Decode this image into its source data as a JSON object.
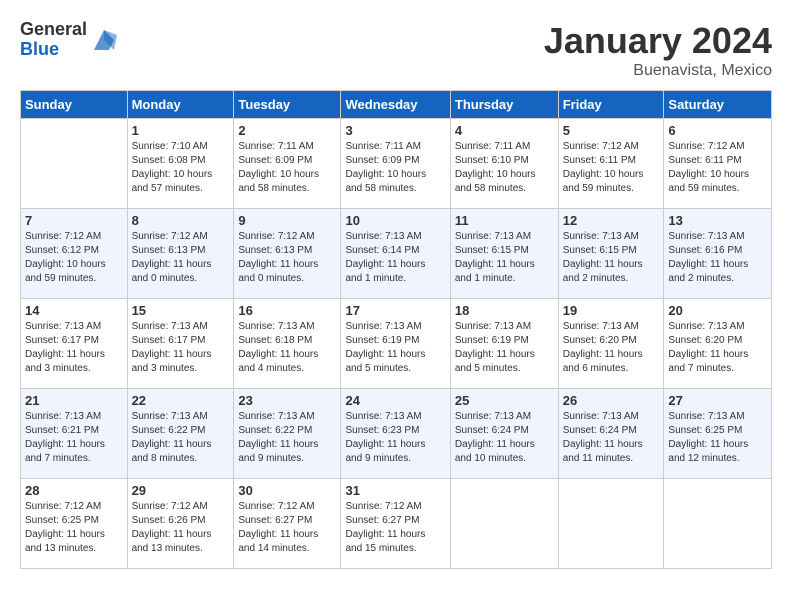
{
  "logo": {
    "general": "General",
    "blue": "Blue"
  },
  "title": "January 2024",
  "subtitle": "Buenavista, Mexico",
  "days": [
    "Sunday",
    "Monday",
    "Tuesday",
    "Wednesday",
    "Thursday",
    "Friday",
    "Saturday"
  ],
  "weeks": [
    [
      {
        "day": "",
        "info": ""
      },
      {
        "day": "1",
        "info": "Sunrise: 7:10 AM\nSunset: 6:08 PM\nDaylight: 10 hours\nand 57 minutes."
      },
      {
        "day": "2",
        "info": "Sunrise: 7:11 AM\nSunset: 6:09 PM\nDaylight: 10 hours\nand 58 minutes."
      },
      {
        "day": "3",
        "info": "Sunrise: 7:11 AM\nSunset: 6:09 PM\nDaylight: 10 hours\nand 58 minutes."
      },
      {
        "day": "4",
        "info": "Sunrise: 7:11 AM\nSunset: 6:10 PM\nDaylight: 10 hours\nand 58 minutes."
      },
      {
        "day": "5",
        "info": "Sunrise: 7:12 AM\nSunset: 6:11 PM\nDaylight: 10 hours\nand 59 minutes."
      },
      {
        "day": "6",
        "info": "Sunrise: 7:12 AM\nSunset: 6:11 PM\nDaylight: 10 hours\nand 59 minutes."
      }
    ],
    [
      {
        "day": "7",
        "info": "Sunrise: 7:12 AM\nSunset: 6:12 PM\nDaylight: 10 hours\nand 59 minutes."
      },
      {
        "day": "8",
        "info": "Sunrise: 7:12 AM\nSunset: 6:13 PM\nDaylight: 11 hours\nand 0 minutes."
      },
      {
        "day": "9",
        "info": "Sunrise: 7:12 AM\nSunset: 6:13 PM\nDaylight: 11 hours\nand 0 minutes."
      },
      {
        "day": "10",
        "info": "Sunrise: 7:13 AM\nSunset: 6:14 PM\nDaylight: 11 hours\nand 1 minute."
      },
      {
        "day": "11",
        "info": "Sunrise: 7:13 AM\nSunset: 6:15 PM\nDaylight: 11 hours\nand 1 minute."
      },
      {
        "day": "12",
        "info": "Sunrise: 7:13 AM\nSunset: 6:15 PM\nDaylight: 11 hours\nand 2 minutes."
      },
      {
        "day": "13",
        "info": "Sunrise: 7:13 AM\nSunset: 6:16 PM\nDaylight: 11 hours\nand 2 minutes."
      }
    ],
    [
      {
        "day": "14",
        "info": "Sunrise: 7:13 AM\nSunset: 6:17 PM\nDaylight: 11 hours\nand 3 minutes."
      },
      {
        "day": "15",
        "info": "Sunrise: 7:13 AM\nSunset: 6:17 PM\nDaylight: 11 hours\nand 3 minutes."
      },
      {
        "day": "16",
        "info": "Sunrise: 7:13 AM\nSunset: 6:18 PM\nDaylight: 11 hours\nand 4 minutes."
      },
      {
        "day": "17",
        "info": "Sunrise: 7:13 AM\nSunset: 6:19 PM\nDaylight: 11 hours\nand 5 minutes."
      },
      {
        "day": "18",
        "info": "Sunrise: 7:13 AM\nSunset: 6:19 PM\nDaylight: 11 hours\nand 5 minutes."
      },
      {
        "day": "19",
        "info": "Sunrise: 7:13 AM\nSunset: 6:20 PM\nDaylight: 11 hours\nand 6 minutes."
      },
      {
        "day": "20",
        "info": "Sunrise: 7:13 AM\nSunset: 6:20 PM\nDaylight: 11 hours\nand 7 minutes."
      }
    ],
    [
      {
        "day": "21",
        "info": "Sunrise: 7:13 AM\nSunset: 6:21 PM\nDaylight: 11 hours\nand 7 minutes."
      },
      {
        "day": "22",
        "info": "Sunrise: 7:13 AM\nSunset: 6:22 PM\nDaylight: 11 hours\nand 8 minutes."
      },
      {
        "day": "23",
        "info": "Sunrise: 7:13 AM\nSunset: 6:22 PM\nDaylight: 11 hours\nand 9 minutes."
      },
      {
        "day": "24",
        "info": "Sunrise: 7:13 AM\nSunset: 6:23 PM\nDaylight: 11 hours\nand 9 minutes."
      },
      {
        "day": "25",
        "info": "Sunrise: 7:13 AM\nSunset: 6:24 PM\nDaylight: 11 hours\nand 10 minutes."
      },
      {
        "day": "26",
        "info": "Sunrise: 7:13 AM\nSunset: 6:24 PM\nDaylight: 11 hours\nand 11 minutes."
      },
      {
        "day": "27",
        "info": "Sunrise: 7:13 AM\nSunset: 6:25 PM\nDaylight: 11 hours\nand 12 minutes."
      }
    ],
    [
      {
        "day": "28",
        "info": "Sunrise: 7:12 AM\nSunset: 6:25 PM\nDaylight: 11 hours\nand 13 minutes."
      },
      {
        "day": "29",
        "info": "Sunrise: 7:12 AM\nSunset: 6:26 PM\nDaylight: 11 hours\nand 13 minutes."
      },
      {
        "day": "30",
        "info": "Sunrise: 7:12 AM\nSunset: 6:27 PM\nDaylight: 11 hours\nand 14 minutes."
      },
      {
        "day": "31",
        "info": "Sunrise: 7:12 AM\nSunset: 6:27 PM\nDaylight: 11 hours\nand 15 minutes."
      },
      {
        "day": "",
        "info": ""
      },
      {
        "day": "",
        "info": ""
      },
      {
        "day": "",
        "info": ""
      }
    ]
  ]
}
